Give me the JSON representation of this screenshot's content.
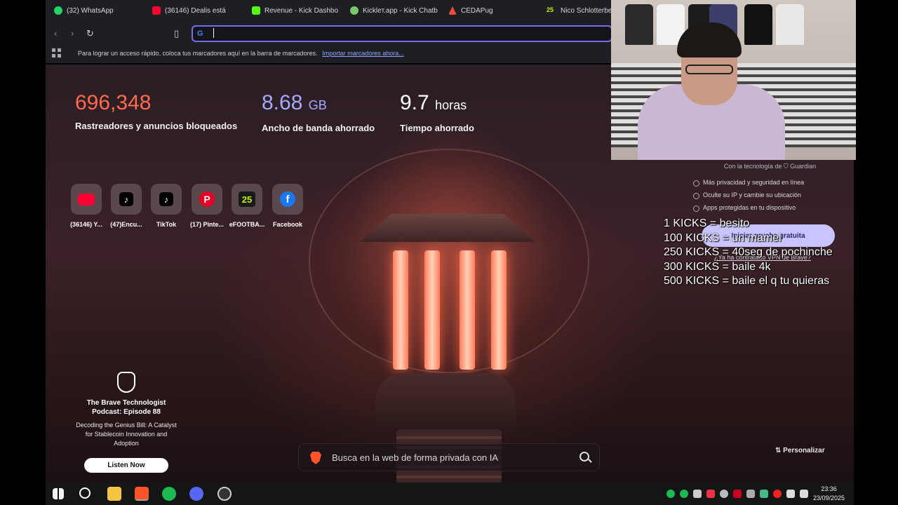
{
  "tabs": [
    {
      "label": "(32) WhatsApp",
      "icon": "whatsapp-icon",
      "color": "#25d366"
    },
    {
      "label": "(36146) Dealis está",
      "icon": "youtube-icon",
      "color": "#ff0033"
    },
    {
      "label": "Revenue - Kick Dashbo",
      "icon": "kick-icon",
      "color": "#53fc18"
    },
    {
      "label": "Kickleт.app - Kick Chatb",
      "icon": "kicklet-icon",
      "color": "#7bc96f"
    },
    {
      "label": "CEDAPug",
      "icon": "cedapug-icon",
      "color": "#e84c3d"
    },
    {
      "label": "Nico Schlotterbec",
      "icon": "efootball-icon",
      "color": "#c8f000"
    }
  ],
  "toolbar": {
    "url_value": ""
  },
  "bookmarks": {
    "message": "Para lograr un acceso rápido, coloca tus marcadores aquí en la barra de marcadores.",
    "import_link": "Importar marcadores ahora..."
  },
  "stats": {
    "trackers": {
      "value": "696,348",
      "label": "Rastreadores y anuncios bloqueados",
      "color": "#ff6a4d"
    },
    "bandwidth": {
      "value": "8.68",
      "unit": "GB",
      "label": "Ancho de banda ahorrado",
      "color": "#a5a8ff"
    },
    "time": {
      "value": "9.7",
      "unit": "horas",
      "label": "Tiempo ahorrado",
      "color": "#ffffff"
    }
  },
  "top_sites": [
    {
      "label": "(36146) Y...",
      "icon": "youtube-icon"
    },
    {
      "label": "(47)Encu...",
      "icon": "tiktok-icon"
    },
    {
      "label": "TikTok",
      "icon": "tiktok-icon"
    },
    {
      "label": "(17) Pinte...",
      "icon": "pinterest-icon"
    },
    {
      "label": "eFOOTBA...",
      "icon": "efootball-icon"
    },
    {
      "label": "Facebook",
      "icon": "facebook-icon"
    }
  ],
  "vpn": {
    "powered_by": "Con la tecnología de ⛉ Guardian",
    "features": [
      "Más privacidad y seguridad en línea",
      "Oculte su IP y cambie su ubicación",
      "Apps protegidas en tu dispositivo"
    ],
    "button": "Iniciar prueba gratuita",
    "link": "¿Ya ha contratado VPN de Brave?"
  },
  "promo": {
    "title": "The Brave Technologist Podcast: Episode 88",
    "subtitle": "Decoding the Genius Bill: A Catalyst for Stablecoin Innovation and Adoption",
    "button": "Listen Now"
  },
  "search": {
    "placeholder": "Busca en la web de forma privada con IA"
  },
  "customize": "⇅ Personalizar",
  "overlay": {
    "lines": [
      "1 KICKS = besito",
      "100 KICKS = un mamel",
      "250 KICKS = 40seg de pochinche",
      "300 KICKS = baile 4k",
      "500 KICKS = baile el q tu quieras"
    ]
  },
  "taskbar": {
    "apps": [
      "windows-start-icon",
      "search-icon",
      "file-explorer-icon",
      "brave-icon",
      "spotify-icon",
      "discord-icon",
      "obs-icon"
    ],
    "time": "23:36",
    "date": "23/09/2025"
  }
}
